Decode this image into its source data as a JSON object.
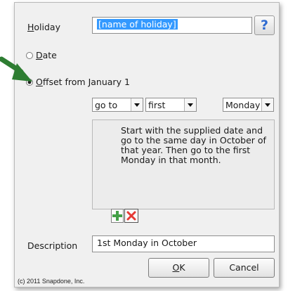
{
  "dialog": {
    "holiday_label": "Holiday",
    "holiday_value": "[name of holiday]",
    "help_label": "?",
    "date_option_label": "Date",
    "offset_option_label": "Offset from January 1",
    "selected_option": "offset",
    "combo_action": "go to",
    "combo_ordinal": "first",
    "combo_weekday": "Monday",
    "explanation": "Start with the supplied date and go to the same day in October of that year. Then go to the first Monday in that month.",
    "description_label": "Description",
    "description_value": "1st Monday in October",
    "ok_label": "OK",
    "cancel_label": "Cancel",
    "copyright": "(c) 2011 Snapdone, Inc."
  },
  "icons": {
    "add": "green-plus-icon",
    "delete": "red-x-icon",
    "pointer": "green-arrow-icon"
  },
  "colors": {
    "selection_highlight": "#3399ff",
    "arrow": "#2e7d32",
    "add_icon": "#43a047",
    "delete_icon": "#e53935",
    "help_icon": "#2f6bd1"
  }
}
